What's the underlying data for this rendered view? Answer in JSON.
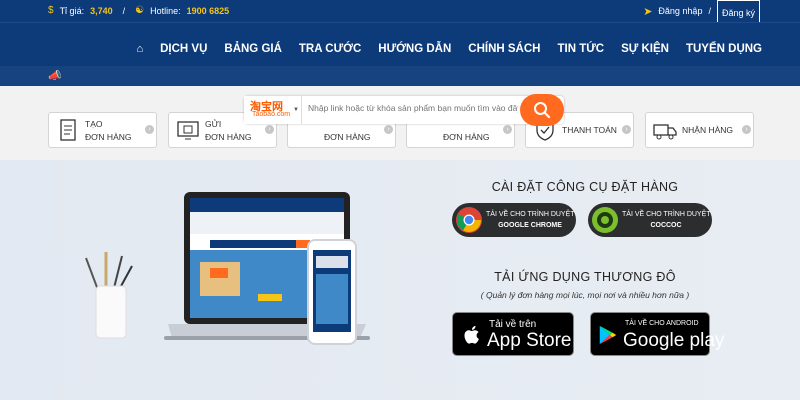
{
  "topbar": {
    "rate_label": "Tỉ giá:",
    "rate_value": "3,740",
    "separator": "/",
    "hotline_label": "Hotline:",
    "hotline_value": "1900 6825",
    "login": "Đăng nhập",
    "auth_separator": "/",
    "register": "Đăng ký"
  },
  "nav": {
    "items": [
      "DỊCH VỤ",
      "BẢNG GIÁ",
      "TRA CƯỚC",
      "HƯỚNG DẪN",
      "CHÍNH SÁCH",
      "TIN TỨC",
      "SỰ KIỆN",
      "TUYỂN DỤNG"
    ]
  },
  "search": {
    "site_logo": "淘宝网",
    "site_url": "Taobao.com",
    "placeholder": "Nhập link hoặc từ khóa sản phẩm bạn muốn tìm vào đây..."
  },
  "services": [
    {
      "line1": "TẠO",
      "line2": "ĐƠN HÀNG"
    },
    {
      "line1": "GỬI",
      "line2": "ĐƠN HÀNG"
    },
    {
      "line1": "",
      "line2": "ĐƠN HÀNG"
    },
    {
      "line1": "",
      "line2": "ĐƠN HÀNG"
    },
    {
      "line1": "THANH TOÁN",
      "line2": ""
    },
    {
      "line1": "NHẬN HÀNG",
      "line2": ""
    }
  ],
  "tools": {
    "title": "CÀI ĐẶT CÔNG CỤ ĐẶT HÀNG",
    "chrome": {
      "line1": "TẢI VỀ CHO TRÌNH DUYỆT",
      "line2": "GOOGLE CHROME"
    },
    "coccoc": {
      "line1": "TẢI VỀ CHO TRÌNH DUYỆT",
      "line2": "COCCOC"
    }
  },
  "apps": {
    "title": "TẢI ỨNG DỤNG THƯƠNG ĐÔ",
    "subtitle": "( Quản lý đơn hàng mọi lúc, mọi nơi và nhiều hơn nữa )",
    "appstore": {
      "line1": "Tải về trên",
      "line2": "App Store"
    },
    "googleplay": {
      "line1": "TẢI VỀ CHO ANDROID",
      "line2": "Google play"
    }
  },
  "colors": {
    "navy": "#0d3a78",
    "accent_yellow": "#f5c518",
    "search_orange": "#ff6a1f"
  }
}
